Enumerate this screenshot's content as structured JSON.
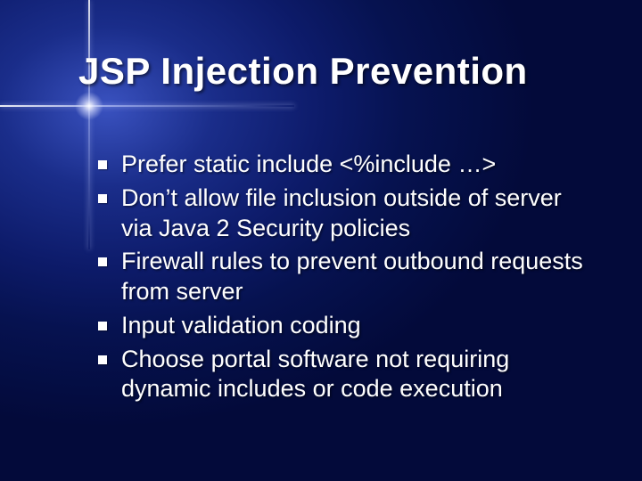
{
  "slide": {
    "title": "JSP Injection Prevention",
    "bullets": [
      "Prefer static include <%include …>",
      "Don’t allow file inclusion outside of server via Java 2 Security policies",
      "Firewall rules to prevent outbound requests from server",
      "Input validation coding",
      "Choose portal software not requiring dynamic includes or code execution"
    ]
  }
}
